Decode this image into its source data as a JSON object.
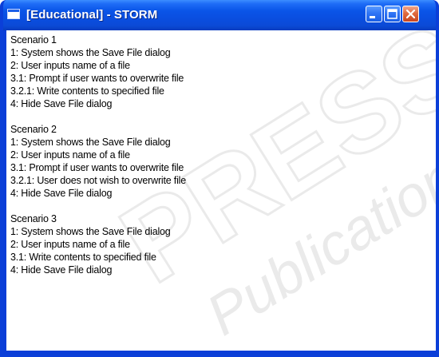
{
  "window": {
    "title": "[Educational] - STORM",
    "icons": {
      "app": "window-icon",
      "minimize": "minimize-icon",
      "maximize": "maximize-icon",
      "close": "close-icon"
    },
    "colors": {
      "titlebar": "#0a4ee0",
      "close_button": "#e06a3f",
      "content_background": "#ffffff"
    }
  },
  "scenarios": [
    {
      "title": "Scenario 1",
      "steps": [
        "1: System shows the Save File dialog",
        "2: User inputs name of a file",
        "3.1: Prompt if user wants to overwrite file",
        "3.2.1: Write contents to specified file",
        "4: Hide Save File dialog"
      ]
    },
    {
      "title": "Scenario 2",
      "steps": [
        "1: System shows the Save File dialog",
        "2: User inputs name of a file",
        "3.1: Prompt if user wants to overwrite file",
        "3.2.1: User does not wish to overwrite file",
        "4: Hide Save File dialog"
      ]
    },
    {
      "title": "Scenario 3",
      "steps": [
        "1: System shows the Save File dialog",
        "2: User inputs name of a file",
        "3.1: Write contents to specified file",
        "4: Hide Save File dialog"
      ]
    }
  ],
  "watermark": {
    "lines": [
      "PRESS",
      "Publications"
    ]
  }
}
